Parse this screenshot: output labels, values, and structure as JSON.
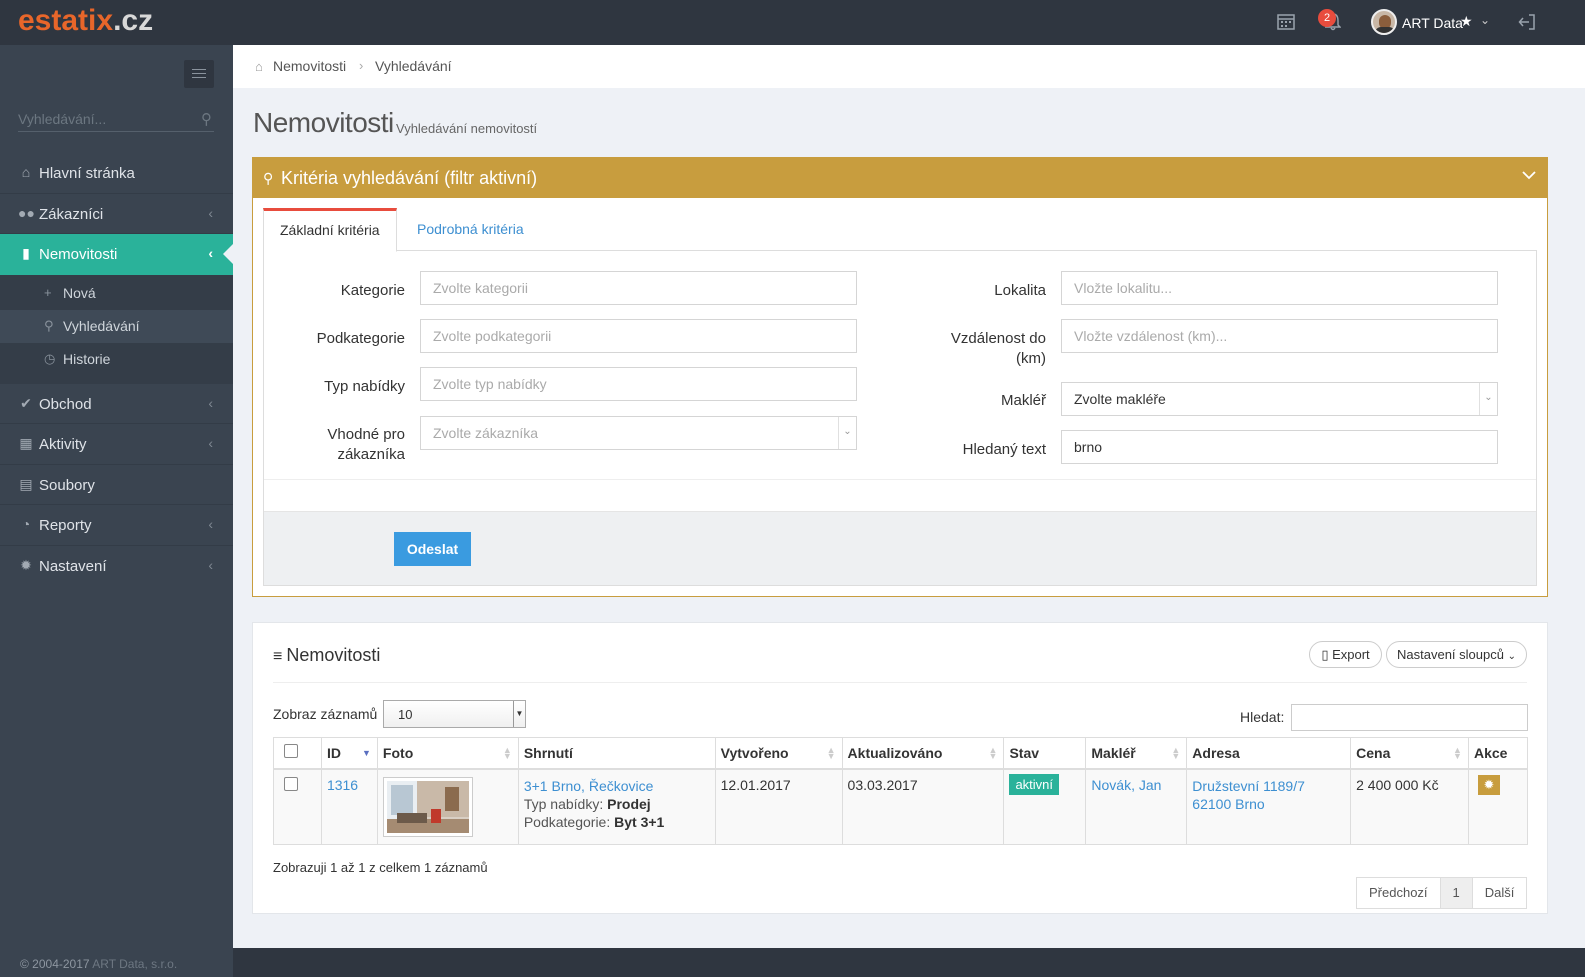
{
  "header": {
    "logo_part1": "estatix",
    "logo_part2": ".cz",
    "notifications_count": "2",
    "user_name": "ART Data"
  },
  "sidebar": {
    "search_placeholder": "Vyhledávání...",
    "items": [
      {
        "label": "Hlavní stránka"
      },
      {
        "label": "Zákazníci"
      },
      {
        "label": "Nemovitosti"
      },
      {
        "label": "Obchod"
      },
      {
        "label": "Aktivity"
      },
      {
        "label": "Soubory"
      },
      {
        "label": "Reporty"
      },
      {
        "label": "Nastavení"
      }
    ],
    "subitems": [
      {
        "label": "Nová"
      },
      {
        "label": "Vyhledávání"
      },
      {
        "label": "Historie"
      }
    ],
    "copyright": "© 2004-2017",
    "copyright_company": "ART Data, s.r.o."
  },
  "breadcrumb": {
    "item1": "Nemovitosti",
    "item2": "Vyhledávání"
  },
  "page": {
    "title": "Nemovitosti",
    "subtitle": "Vyhledávání nemovitostí"
  },
  "filter": {
    "title": "Kritéria vyhledávání (filtr aktivní)",
    "tab_basic": "Základní kritéria",
    "tab_detail": "Podrobná kritéria",
    "category_label": "Kategorie",
    "category_placeholder": "Zvolte kategorii",
    "subcategory_label": "Podkategorie",
    "subcategory_placeholder": "Zvolte podkategorii",
    "offer_type_label": "Typ nabídky",
    "offer_type_placeholder": "Zvolte typ nabídky",
    "customer_label_1": "Vhodné pro",
    "customer_label_2": "zákazníka",
    "customer_placeholder": "Zvolte zákazníka",
    "location_label": "Lokalita",
    "location_placeholder": "Vložte lokalitu...",
    "distance_label_1": "Vzdálenost do",
    "distance_label_2": "(km)",
    "distance_placeholder": "Vložte vzdálenost (km)...",
    "broker_label": "Makléř",
    "broker_value": "Zvolte makléře",
    "text_label": "Hledaný text",
    "text_value": "brno",
    "submit_label": "Odeslat"
  },
  "results": {
    "title": "Nemovitosti",
    "export_label": "Export",
    "columns_label": "Nastavení sloupců",
    "show_label": "Zobraz záznamů",
    "page_size": "10",
    "search_label": "Hledat:",
    "columns": [
      "ID",
      "Foto",
      "Shrnutí",
      "Vytvořeno",
      "Aktualizováno",
      "Stav",
      "Makléř",
      "Adresa",
      "Cena",
      "Akce"
    ],
    "rows": [
      {
        "id": "1316",
        "summary_title": "3+1 Brno, Řečkovice",
        "offer_type_label": "Typ nabídky:",
        "offer_type": "Prodej",
        "subcategory_label": "Podkategorie:",
        "subcategory": "Byt 3+1",
        "created": "12.01.2017",
        "updated": "03.03.2017",
        "status": "aktivní",
        "broker": "Novák, Jan",
        "address_line1": "Družstevní 1189/7",
        "address_line2": "62100 Brno",
        "price": "2 400 000 Kč"
      }
    ],
    "info": "Zobrazuji 1 až 1 z celkem 1 záznamů",
    "pager_prev": "Předchozí",
    "pager_page": "1",
    "pager_next": "Další"
  },
  "colors": {
    "accent": "#2ab29a",
    "filter": "#c89d3e",
    "primary": "#3a9be0",
    "topbar": "#2f3640",
    "sidebar": "#3a4450"
  }
}
